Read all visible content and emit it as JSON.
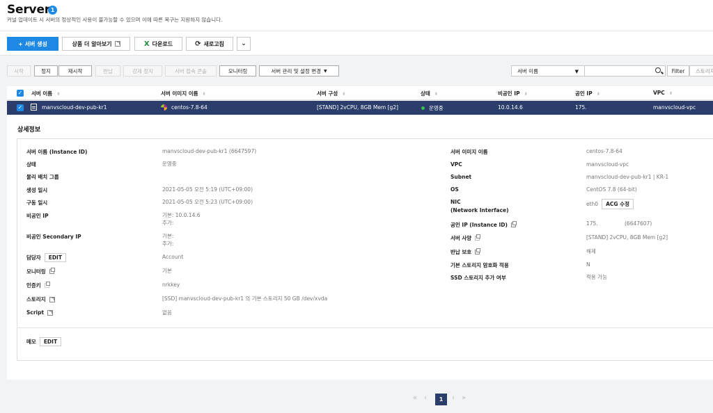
{
  "header": {
    "title": "Server",
    "badge": "1",
    "subtitle": "커널 업데이트 시 서버의 정상적인 사용이 불가능할 수 있으며 이에 따른 복구는 지원하지 않습니다."
  },
  "toolbar": {
    "create": "+ 서버 생성",
    "learn_more": "상품 더 알아보기",
    "download": "다운로드",
    "refresh": "새로고침"
  },
  "actions": {
    "start": "시작",
    "stop": "정지",
    "restart": "재시작",
    "return": "반납",
    "force_stop": "강제 정지",
    "console": "서버 접속 콘솔",
    "monitoring": "모니터링",
    "manage": "서버 관리 및 설정 변경"
  },
  "search": {
    "select_value": "서버 이름",
    "filter": "Filter",
    "store_placeholder": "스토리지"
  },
  "table": {
    "headers": [
      "서버 이름",
      "서버 이미지 이름",
      "서버 구성",
      "상태",
      "비공인 IP",
      "공인 IP",
      "VPC"
    ],
    "row": {
      "name": "manvscloud-dev-pub-kr1",
      "image": "centos-7.8-64",
      "spec": "[STAND] 2vCPU, 8GB Mem [g2]",
      "status": "운영중",
      "private_ip": "10.0.14.6",
      "public_ip": "175.",
      "vpc": "manvscloud-vpc"
    }
  },
  "detail": {
    "title": "상세정보",
    "edit": "EDIT",
    "acg": "ACG 수정",
    "left": [
      {
        "label": "서버 이름 (Instance ID)",
        "value": "manvscloud-dev-pub-kr1 (6647597)"
      },
      {
        "label": "상태",
        "value": "운영중"
      },
      {
        "label": "물리 배치 그룹",
        "value": ""
      },
      {
        "label": "생성 일시",
        "value": "2021-05-05 오전 5:19 (UTC+09:00)"
      },
      {
        "label": "구동 일시",
        "value": "2021-05-05 오전 5:23 (UTC+09:00)"
      },
      {
        "label": "비공인 IP",
        "value": "기본: 10.0.14.6",
        "value2": "추가:"
      },
      {
        "label": "비공인 Secondary IP",
        "value": "기본:",
        "value2": "추가:"
      },
      {
        "label": "담당자",
        "value": "Account"
      },
      {
        "label": "모니터링",
        "value": "기본"
      },
      {
        "label": "인증키",
        "value": "nrkkey"
      },
      {
        "label": "스토리지",
        "value": "[SSD] manvscloud-dev-pub-kr1 의 기본 스토리지  50 GB /dev/xvda"
      },
      {
        "label": "Script",
        "value": "없음"
      }
    ],
    "right": [
      {
        "label": "서버 이미지 이름",
        "value": "centos-7.8-64"
      },
      {
        "label": "VPC",
        "value": "manvscloud-vpc"
      },
      {
        "label": "Subnet",
        "value": "manvscloud-dev-pub-kr1 | KR-1"
      },
      {
        "label": "OS",
        "value": "CentOS 7.8 (64-bit)"
      },
      {
        "label": "NIC",
        "label2": "(Network Interface)",
        "value": "eth0"
      },
      {
        "label": "공인 IP (Instance ID)",
        "value": "175.",
        "value2": "(6647607)"
      },
      {
        "label": "서버 사양",
        "value": "[STAND] 2vCPU, 8GB Mem [g2]"
      },
      {
        "label": "반납 보호",
        "value": "해제"
      },
      {
        "label": "기본 스토리지 암호화 적용",
        "value": "N"
      },
      {
        "label": "SSD 스토리지 추가 여부",
        "value": "적용 가능"
      }
    ],
    "memo_label": "메모"
  },
  "pagination": {
    "current": "1"
  }
}
